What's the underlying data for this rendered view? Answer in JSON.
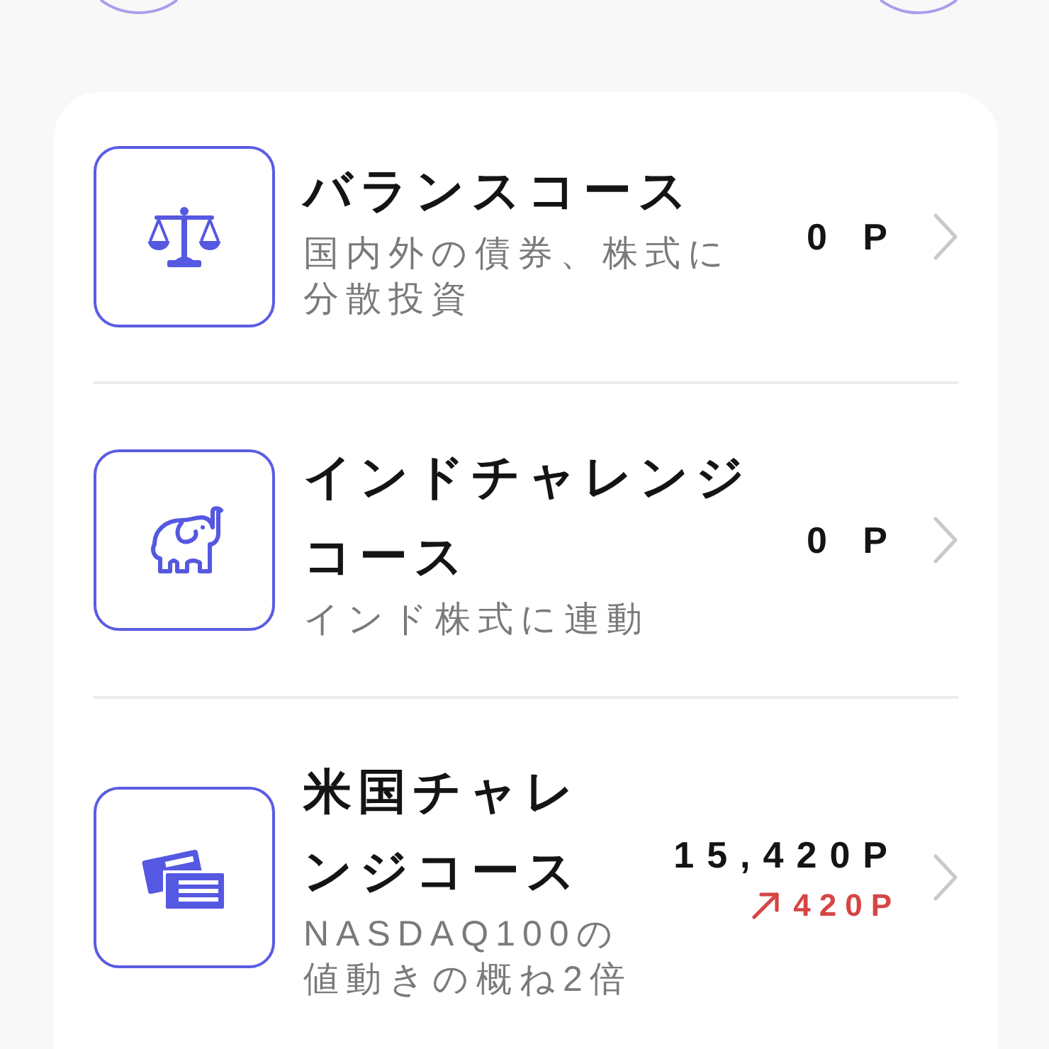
{
  "courses": [
    {
      "title": "バランスコース",
      "description": "国内外の債券、株式に分散投資",
      "points": "0 P"
    },
    {
      "title": "インドチャレンジコース",
      "description": "インド株式に連動",
      "points": "0 P"
    },
    {
      "title": "米国チャレンジコース",
      "description": "NASDAQ100の値動きの概ね2倍",
      "points": "15,420P",
      "change": {
        "rising": true,
        "amount": "420P"
      }
    }
  ]
}
